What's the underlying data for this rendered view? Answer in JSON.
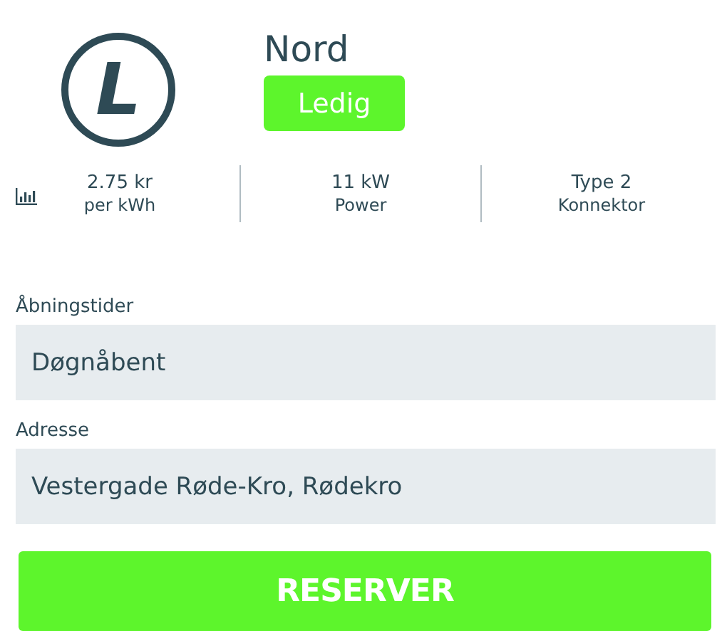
{
  "station": {
    "logo_letter": "L",
    "name": "Nord",
    "status": "Ledig"
  },
  "stats": [
    {
      "value": "2.75 kr",
      "label": "per kWh"
    },
    {
      "value": "11 kW",
      "label": "Power"
    },
    {
      "value": "Type 2",
      "label": "Konnektor"
    }
  ],
  "fields": [
    {
      "label": "Åbningstider",
      "value": "Døgnåbent"
    },
    {
      "label": "Adresse",
      "value": "Vestergade Røde-Kro, Rødekro"
    }
  ],
  "button": "RESERVER"
}
